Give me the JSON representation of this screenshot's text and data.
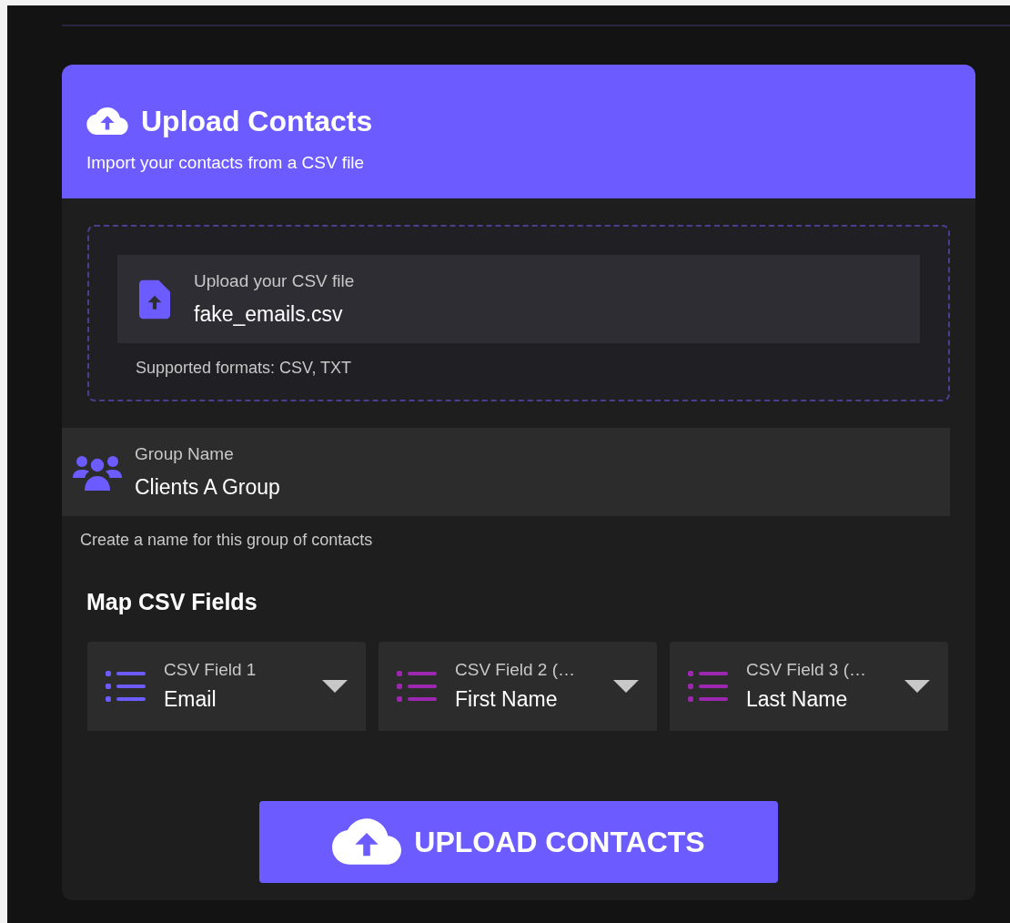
{
  "header": {
    "title": "Upload Contacts",
    "subtitle": "Import your contacts from a CSV file"
  },
  "file_upload": {
    "label": "Upload your CSV file",
    "value": "fake_emails.csv",
    "hint": "Supported formats: CSV, TXT"
  },
  "group_name": {
    "label": "Group Name",
    "value": "Clients A Group",
    "helper": "Create a name for this group of contacts"
  },
  "map_section": {
    "title": "Map CSV Fields",
    "fields": [
      {
        "label": "CSV Field 1",
        "value": "Email",
        "color": "#6c5cff"
      },
      {
        "label": "CSV Field 2 (…",
        "value": "First Name",
        "color": "#9c27b0"
      },
      {
        "label": "CSV Field 3 (…",
        "value": "Last Name",
        "color": "#9c27b0"
      }
    ]
  },
  "submit_button": {
    "label": "UPLOAD CONTACTS"
  }
}
